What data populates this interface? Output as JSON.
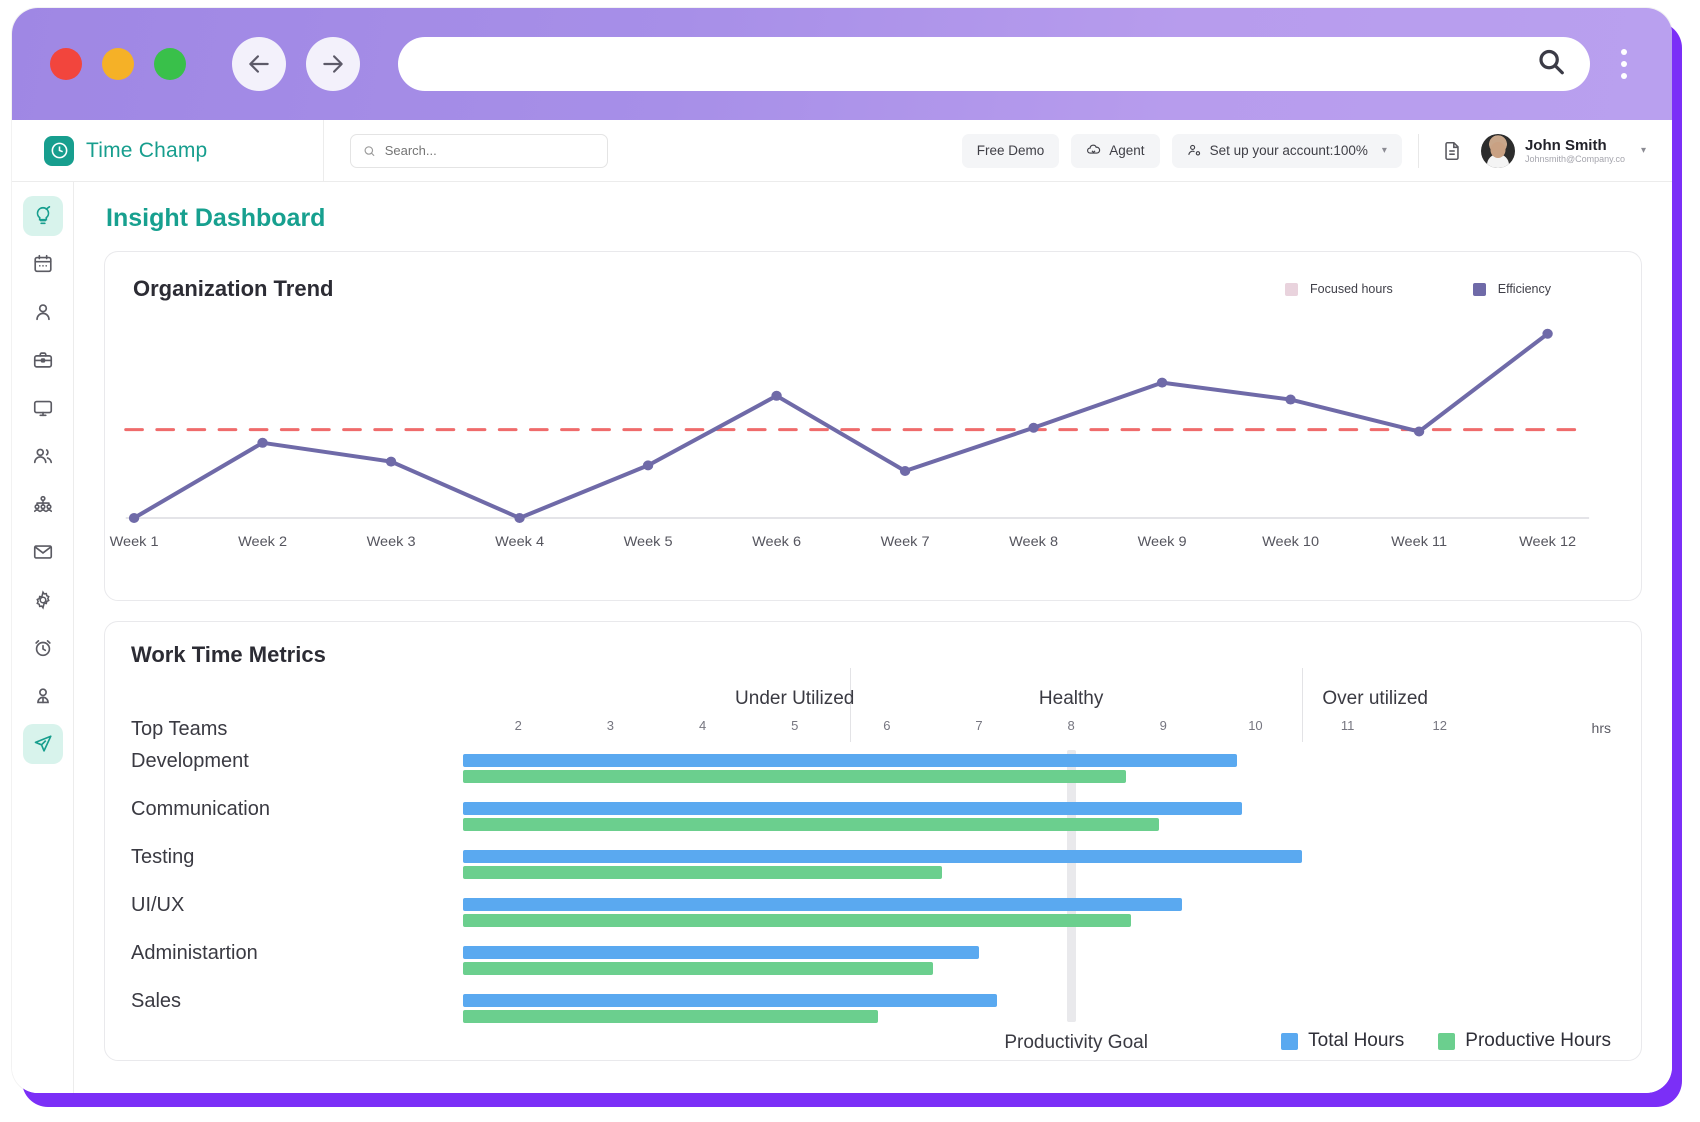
{
  "browser": {
    "url_value": "",
    "url_placeholder": "",
    "back_label": "Back",
    "forward_label": "Forward",
    "menu_label": "More options"
  },
  "header": {
    "brand": "Time Champ",
    "search_placeholder": "Search...",
    "search_value": "",
    "free_demo": "Free Demo",
    "agent": "Agent",
    "setup": "Set up your account:100%",
    "user_name": "John Smith",
    "user_email": "Johnsmith@Company.co"
  },
  "sidebar": {
    "items": [
      {
        "name": "insight",
        "icon": "lightbulb-icon",
        "active": true
      },
      {
        "name": "calendar",
        "icon": "calendar-icon",
        "active": false
      },
      {
        "name": "profile",
        "icon": "user-icon",
        "active": false
      },
      {
        "name": "projects",
        "icon": "briefcase-icon",
        "active": false
      },
      {
        "name": "screens",
        "icon": "monitor-icon",
        "active": false
      },
      {
        "name": "teams",
        "icon": "users-icon",
        "active": false
      },
      {
        "name": "org-chart",
        "icon": "hierarchy-icon",
        "active": false
      },
      {
        "name": "mail",
        "icon": "mail-icon",
        "active": false
      },
      {
        "name": "settings",
        "icon": "gear-icon",
        "active": false
      },
      {
        "name": "timer",
        "icon": "alarm-clock-icon",
        "active": false
      },
      {
        "name": "account",
        "icon": "person-badge-icon",
        "active": false
      },
      {
        "name": "send",
        "icon": "send-icon",
        "active": true
      }
    ]
  },
  "page": {
    "title": "Insight Dashboard"
  },
  "trend": {
    "title": "Organization Trend",
    "legend": [
      {
        "label": "Focused hours",
        "color": "#e9d3dd"
      },
      {
        "label": "Efficiency",
        "color": "#6f6aa8"
      }
    ]
  },
  "metrics": {
    "title": "Work Time Metrics",
    "top_teams_label": "Top Teams",
    "hrs_label": "hrs",
    "goal_label": "Productivity Goal",
    "zones": [
      {
        "label": "Under Utilized",
        "center": 5.0
      },
      {
        "label": "Healthy",
        "center": 8.0
      },
      {
        "label": "Over utilized",
        "center": 11.3
      }
    ],
    "zone_boundaries": [
      5.6,
      10.5
    ],
    "legend": [
      {
        "label": "Total Hours",
        "color": "#5aa9f0"
      },
      {
        "label": "Productive Hours",
        "color": "#6bcf8e"
      }
    ]
  },
  "chart_data": [
    {
      "type": "line",
      "title": "Organization Trend",
      "xlabel": "",
      "ylabel": "",
      "grid": false,
      "legend_position": "top-right",
      "categories": [
        "Week 1",
        "Week 2",
        "Week 3",
        "Week 4",
        "Week 5",
        "Week 6",
        "Week 7",
        "Week 8",
        "Week 9",
        "Week 10",
        "Week 11",
        "Week 12"
      ],
      "ylim": [
        0,
        100
      ],
      "series": [
        {
          "name": "Efficiency",
          "color": "#6f6aa8",
          "values": [
            0,
            40,
            30,
            0,
            28,
            65,
            25,
            48,
            72,
            63,
            46,
            98
          ]
        },
        {
          "name": "Focused hours",
          "color": "#e9d3dd",
          "values": []
        }
      ],
      "annotations": [
        {
          "type": "threshold-line",
          "label": "",
          "value": 47,
          "color": "#ef6b6b",
          "style": "dashed"
        }
      ]
    },
    {
      "type": "bar",
      "orientation": "horizontal",
      "title": "Work Time Metrics",
      "xlabel": "hrs",
      "ylabel": "Top Teams",
      "xlim": [
        1.4,
        12.6
      ],
      "xticks": [
        2,
        3,
        4,
        5,
        6,
        7,
        8,
        9,
        10,
        11,
        12
      ],
      "grid": false,
      "legend_position": "bottom-right",
      "categories": [
        "Development",
        "Communication",
        "Testing",
        "UI/UX",
        "Administartion",
        "Sales"
      ],
      "series": [
        {
          "name": "Total Hours",
          "color": "#5aa9f0",
          "values": [
            9.8,
            9.85,
            10.5,
            9.2,
            7.0,
            7.2
          ]
        },
        {
          "name": "Productive Hours",
          "color": "#6bcf8e",
          "values": [
            8.6,
            8.95,
            6.6,
            8.65,
            6.5,
            5.9
          ]
        }
      ],
      "annotations": [
        {
          "type": "goal-marker",
          "label": "Productivity Goal",
          "value": 8.0,
          "color": "#e9e9ec"
        }
      ]
    }
  ]
}
